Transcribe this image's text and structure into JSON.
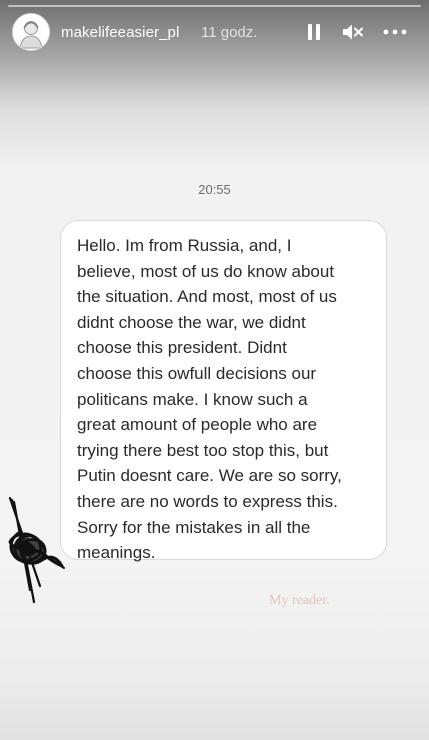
{
  "header": {
    "username": "makelifeeasier_pl",
    "time_ago": "11 godz.",
    "avatar_icon": "profile-avatar",
    "pause_icon": "pause-icon",
    "mute_icon": "speaker-muted-icon",
    "more_icon": "more-dots-icon"
  },
  "progress": {
    "fraction": 1.0
  },
  "chat": {
    "timestamp": "20:55",
    "message": "Hello. Im from Russia, and, I\nbelieve, most of us do know about\nthe situation. And most, most of us\ndidnt choose the war, we didnt\nchoose this president. Didnt\nchoose this owfull decisions our\npoliticans make. I know such a\ngreat amount of people who are\ntrying there best too stop this, but\nPutin doesnt care. We are so sorry,\nthere are no words to express this.\nSorry for the mistakes in all the\nmeanings."
  },
  "caption": "My reader.",
  "colors": {
    "caption": "#e3c3bd",
    "bubble_border": "#d9d9d9",
    "message_text": "#2a2a2a"
  }
}
